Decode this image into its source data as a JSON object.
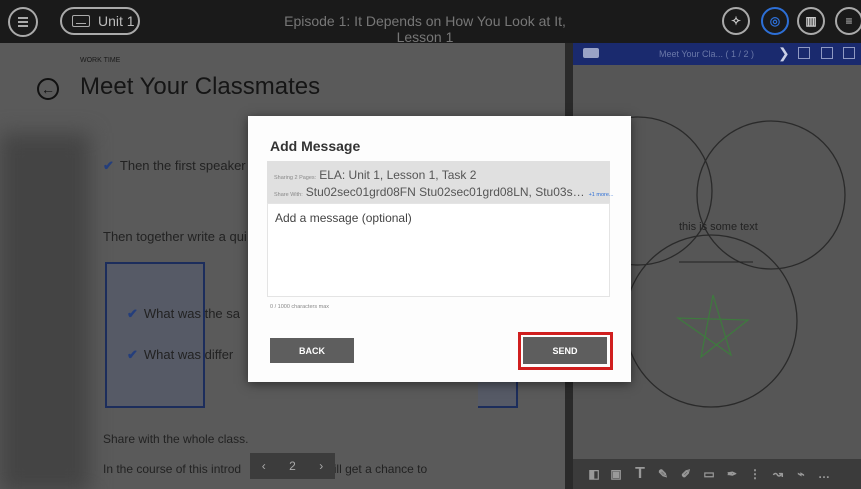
{
  "topbar": {
    "unit_label": "Unit 1",
    "episode_title": "Episode 1: It Depends on How You Look at It, Lesson 1",
    "icons": [
      "menu-icon",
      "keyboard-icon",
      "compass-icon",
      "globe-icon",
      "library-icon",
      "notes-icon"
    ]
  },
  "lesson": {
    "section_label": "WORK TIME",
    "title": "Meet Your Classmates",
    "step_text": "Then the first speaker",
    "together_text": "Then together write a qui",
    "questions": [
      "What was the sa",
      "What was differ"
    ],
    "share_text": "Share with the whole class.",
    "course_text": "In the course of this introd",
    "course_text_tail": "will get a chance to",
    "pager_page": "2"
  },
  "right_panel": {
    "title": "Meet Your Cla... ( 1 / 2 )",
    "canvas_text": "this is some text"
  },
  "dialog": {
    "title": "Add Message",
    "sharing_label": "Sharing 2 Pages:",
    "sharing_value": "ELA: Unit 1, Lesson 1, Task 2",
    "share_with_label": "Share With:",
    "share_with_value": "Stu02sec01grd08FN Stu02sec01grd08LN, Stu03s…",
    "share_with_more": "+1 more...",
    "placeholder": "Add a message (optional)",
    "char_count": "0 / 1000 characters max",
    "back_label": "BACK",
    "send_label": "SEND"
  },
  "colors": {
    "accent_blue": "#2d6fd6",
    "highlight_red": "#d01f1f",
    "button_gray": "#5e5e5e"
  }
}
